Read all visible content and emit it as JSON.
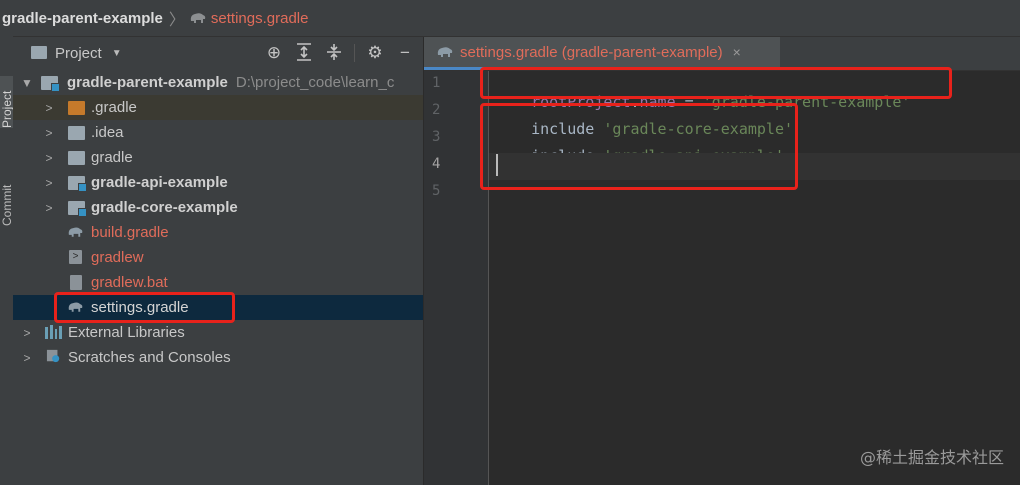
{
  "breadcrumb": {
    "project": "gradle-parent-example",
    "file": "settings.gradle",
    "file_icon": "gradle-elephant-icon"
  },
  "toolstrip": {
    "project_tab": "Project",
    "commit_tab": "Commit"
  },
  "project_panel": {
    "title": "Project",
    "header_icons": [
      "locate-icon",
      "expand-all-icon",
      "collapse-all-icon",
      "gear-icon",
      "minimize-icon"
    ],
    "tree": [
      {
        "label": "gradle-parent-example",
        "path": "D:\\project_code\\learn_c",
        "icon": "module-folder-icon",
        "expanded": true
      },
      {
        "label": ".gradle",
        "icon": "folder-icon",
        "color": "#c57a2b"
      },
      {
        "label": ".idea",
        "icon": "folder-icon"
      },
      {
        "label": "gradle",
        "icon": "folder-icon"
      },
      {
        "label": "gradle-api-example",
        "icon": "module-folder-icon"
      },
      {
        "label": "gradle-core-example",
        "icon": "module-folder-icon"
      },
      {
        "label": "build.gradle",
        "icon": "gradle-elephant-icon"
      },
      {
        "label": "gradlew",
        "icon": "shell-file-icon"
      },
      {
        "label": "gradlew.bat",
        "icon": "bat-file-icon"
      },
      {
        "label": "settings.gradle",
        "icon": "gradle-elephant-icon",
        "selected": true
      },
      {
        "label": "External Libraries",
        "icon": "library-icon"
      },
      {
        "label": "Scratches and Consoles",
        "icon": "scratches-icon"
      }
    ]
  },
  "editor": {
    "tab_label": "settings.gradle (gradle-parent-example)",
    "tab_close": "×",
    "line_numbers": [
      "1",
      "2",
      "3",
      "4",
      "5"
    ],
    "lines": [
      {
        "parts": [
          {
            "t": "rootProject",
            "k": "purple"
          },
          {
            "t": ".",
            "k": "plain"
          },
          {
            "t": "name",
            "k": "purple"
          },
          {
            "t": " = ",
            "k": "plain"
          },
          {
            "t": "'gradle-parent-example'",
            "k": "str"
          }
        ]
      },
      {
        "parts": [
          {
            "t": "include ",
            "k": "plain"
          },
          {
            "t": "'gradle-core-example'",
            "k": "str"
          }
        ]
      },
      {
        "parts": [
          {
            "t": "include ",
            "k": "plain"
          },
          {
            "t": "'gradle-api-example'",
            "k": "str"
          }
        ]
      },
      {
        "parts": []
      },
      {
        "parts": []
      }
    ]
  },
  "watermark": "@稀土掘金技术社区",
  "colors": {
    "highlight_box": "#e8221b",
    "string": "#6a8759",
    "field": "#9876aa",
    "modified_file": "#e06c5a"
  }
}
